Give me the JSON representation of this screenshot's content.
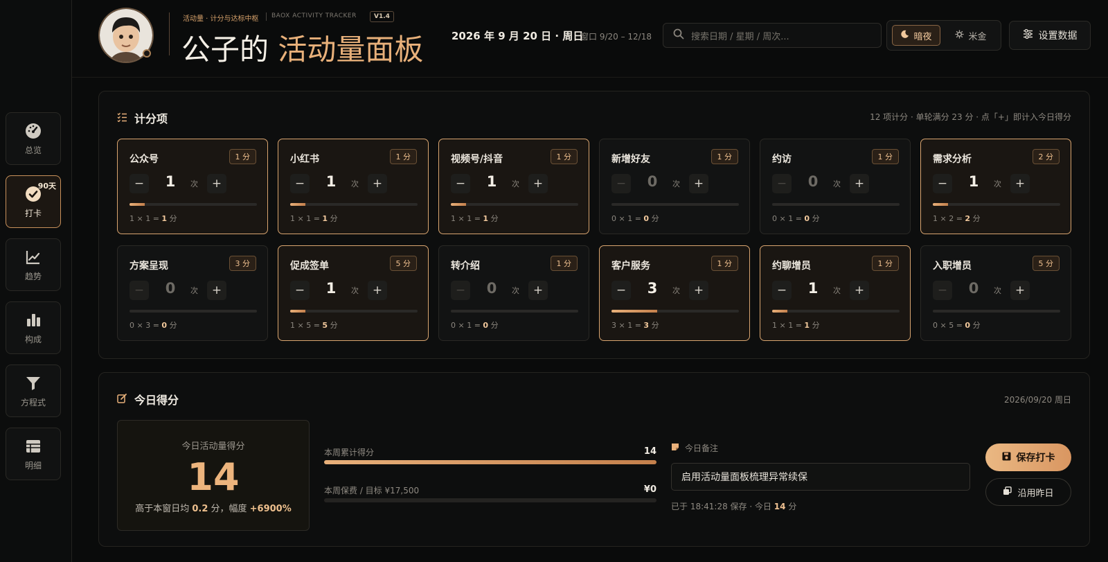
{
  "colors": {
    "accent": "#e8b07a",
    "background": "#0a0b0b",
    "panel": "#0d0e0e"
  },
  "sidebar": {
    "items": [
      {
        "label": "总览",
        "icon": "gauge-icon"
      },
      {
        "label": "打卡",
        "icon": "check-circle-icon",
        "badge": "90天",
        "active": true
      },
      {
        "label": "趋势",
        "icon": "line-chart-icon"
      },
      {
        "label": "构成",
        "icon": "bar-chart-icon"
      },
      {
        "label": "方程式",
        "icon": "funnel-icon"
      },
      {
        "label": "明细",
        "icon": "table-icon"
      }
    ]
  },
  "header": {
    "subtitle": "活动量 · 计分与达标中枢",
    "tracker": "BAOX ACTIVITY TRACKER",
    "version": "V1.4",
    "title_prefix": "公子的",
    "title_accent": "活动量面板",
    "date": "2026 年 9 月 20 日 · 周日",
    "window": "窗口 9/20 – 12/18",
    "search_placeholder": "搜索日期 / 星期 / 周次...",
    "theme_dark": "暗夜",
    "theme_gold": "米金",
    "settings": "设置数据"
  },
  "scoring": {
    "title": "计分项",
    "meta": "12 项计分 · 单轮满分 23 分 · 点「+」即计入今日得分",
    "unit": "次",
    "items": [
      {
        "name": "公众号",
        "points": "1 分",
        "count": "1",
        "formula_prefix": "1 × 1 = ",
        "formula_value": "1",
        "formula_suffix": " 分",
        "active": true,
        "progress": 0.12
      },
      {
        "name": "小红书",
        "points": "1 分",
        "count": "1",
        "formula_prefix": "1 × 1 = ",
        "formula_value": "1",
        "formula_suffix": " 分",
        "active": true,
        "progress": 0.12
      },
      {
        "name": "视频号/抖音",
        "points": "1 分",
        "count": "1",
        "formula_prefix": "1 × 1 = ",
        "formula_value": "1",
        "formula_suffix": " 分",
        "active": true,
        "progress": 0.12
      },
      {
        "name": "新增好友",
        "points": "1 分",
        "count": "0",
        "formula_prefix": "0 × 1 = ",
        "formula_value": "0",
        "formula_suffix": " 分",
        "active": false,
        "progress": 0
      },
      {
        "name": "约访",
        "points": "1 分",
        "count": "0",
        "formula_prefix": "0 × 1 = ",
        "formula_value": "0",
        "formula_suffix": " 分",
        "active": false,
        "progress": 0
      },
      {
        "name": "需求分析",
        "points": "2 分",
        "count": "1",
        "formula_prefix": "1 × 2 = ",
        "formula_value": "2",
        "formula_suffix": " 分",
        "active": true,
        "progress": 0.12
      },
      {
        "name": "方案呈现",
        "points": "3 分",
        "count": "0",
        "formula_prefix": "0 × 3 = ",
        "formula_value": "0",
        "formula_suffix": " 分",
        "active": false,
        "progress": 0
      },
      {
        "name": "促成签单",
        "points": "5 分",
        "count": "1",
        "formula_prefix": "1 × 5 = ",
        "formula_value": "5",
        "formula_suffix": " 分",
        "active": true,
        "progress": 0.12
      },
      {
        "name": "转介绍",
        "points": "1 分",
        "count": "0",
        "formula_prefix": "0 × 1 = ",
        "formula_value": "0",
        "formula_suffix": " 分",
        "active": false,
        "progress": 0
      },
      {
        "name": "客户服务",
        "points": "1 分",
        "count": "3",
        "formula_prefix": "3 × 1 = ",
        "formula_value": "3",
        "formula_suffix": " 分",
        "active": true,
        "progress": 0.36
      },
      {
        "name": "约聊增员",
        "points": "1 分",
        "count": "1",
        "formula_prefix": "1 × 1 = ",
        "formula_value": "1",
        "formula_suffix": " 分",
        "active": true,
        "progress": 0.12
      },
      {
        "name": "入职增员",
        "points": "5 分",
        "count": "0",
        "formula_prefix": "0 × 5 = ",
        "formula_value": "0",
        "formula_suffix": " 分",
        "active": false,
        "progress": 0
      }
    ]
  },
  "today": {
    "title": "今日得分",
    "date": "2026/09/20 周日",
    "score_label": "今日活动量得分",
    "score": "14",
    "compare_prefix": "高于本窗日均 ",
    "compare_avg": "0.2",
    "compare_mid": " 分，幅度 ",
    "compare_pct": "+6900%",
    "week_label": "本周累计得分",
    "week_value": "14",
    "week_progress": 1.0,
    "premium_label": "本周保费 / 目标 ¥17,500",
    "premium_value": "¥0",
    "premium_progress": 0,
    "note_label": "今日备注",
    "note_value": "启用活动量面板梳理异常续保",
    "status_prefix": "已于 18:41:28 保存 · 今日 ",
    "status_value": "14",
    "status_suffix": " 分",
    "save_label": "保存打卡",
    "reuse_label": "沿用昨日"
  }
}
